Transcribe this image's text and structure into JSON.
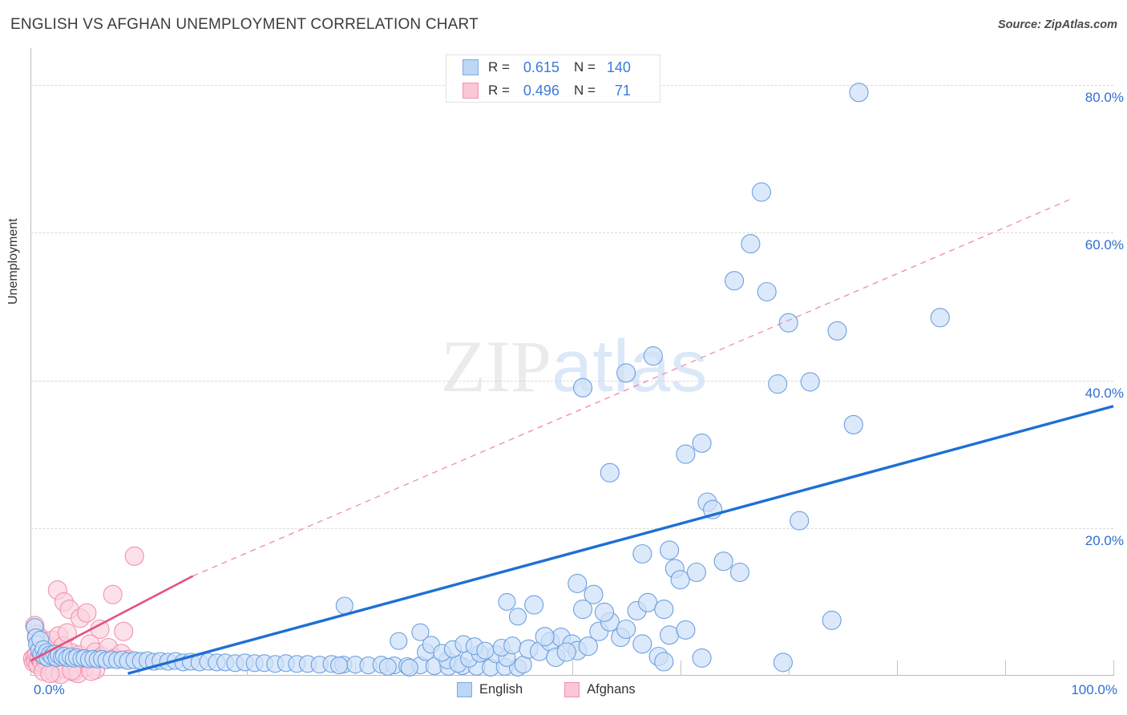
{
  "header": {
    "title": "ENGLISH VS AFGHAN UNEMPLOYMENT CORRELATION CHART",
    "source": "Source: ZipAtlas.com"
  },
  "watermark": {
    "part1": "ZIP",
    "part2": "atlas"
  },
  "stats": {
    "rows": [
      {
        "series": "English",
        "r_label": "R =",
        "r_value": "0.615",
        "n_label": "N =",
        "n_value": "140",
        "color": "#bcd7f5"
      },
      {
        "series": "Afghans",
        "r_label": "R =",
        "r_value": "0.496",
        "n_label": "N =",
        "n_value": "71",
        "color": "#fbc6d6"
      }
    ]
  },
  "legend": {
    "items": [
      {
        "label": "English",
        "color": "#bcd7f5"
      },
      {
        "label": "Afghans",
        "color": "#fbc6d6"
      }
    ]
  },
  "axes": {
    "y_title": "Unemployment",
    "y_ticks": [
      "80.0%",
      "60.0%",
      "40.0%",
      "20.0%"
    ],
    "x_left": "0.0%",
    "x_right": "100.0%"
  },
  "chart_data": {
    "type": "scatter",
    "title": "ENGLISH VS AFGHAN UNEMPLOYMENT CORRELATION CHART",
    "xlabel": "",
    "ylabel": "Unemployment",
    "xlim": [
      0,
      100
    ],
    "ylim": [
      0,
      85
    ],
    "x_unit": "%",
    "y_unit": "%",
    "grid": true,
    "y_gridlines": [
      20,
      40,
      60,
      80
    ],
    "x_ticks": [
      0,
      10,
      20,
      30,
      40,
      50,
      60,
      70,
      80,
      90,
      100
    ],
    "legend_position": "bottom-center",
    "statistics": [
      {
        "series": "English",
        "R": 0.615,
        "N": 140
      },
      {
        "series": "Afghans",
        "R": 0.496,
        "N": 71
      }
    ],
    "series": [
      {
        "name": "English",
        "color": "#cfe1f8",
        "edge_color": "#6ca0e0",
        "trendline": {
          "style": "solid",
          "color": "#1f6fd4",
          "x0": 9.0,
          "y0": 0.3,
          "x1": 100.0,
          "y1": 36.5
        },
        "points": [
          [
            0.4,
            6.6
          ],
          [
            0.5,
            5.2
          ],
          [
            0.6,
            4.3
          ],
          [
            0.8,
            3.5
          ],
          [
            0.9,
            4.9
          ],
          [
            1.0,
            3.0
          ],
          [
            1.2,
            3.6
          ],
          [
            1.3,
            2.6
          ],
          [
            1.5,
            3.2
          ],
          [
            1.6,
            2.4
          ],
          [
            1.8,
            2.9
          ],
          [
            2.0,
            2.6
          ],
          [
            2.2,
            3.0
          ],
          [
            2.4,
            2.4
          ],
          [
            2.6,
            2.8
          ],
          [
            2.9,
            2.5
          ],
          [
            3.1,
            2.7
          ],
          [
            3.4,
            2.4
          ],
          [
            3.7,
            2.6
          ],
          [
            4.0,
            2.3
          ],
          [
            4.3,
            2.5
          ],
          [
            4.7,
            2.3
          ],
          [
            5.0,
            2.4
          ],
          [
            5.4,
            2.2
          ],
          [
            5.8,
            2.3
          ],
          [
            6.2,
            2.2
          ],
          [
            6.6,
            2.3
          ],
          [
            7.0,
            2.1
          ],
          [
            7.5,
            2.2
          ],
          [
            8.0,
            2.1
          ],
          [
            8.5,
            2.2
          ],
          [
            9.0,
            2.0
          ],
          [
            9.6,
            2.1
          ],
          [
            10.2,
            2.0
          ],
          [
            10.8,
            2.1
          ],
          [
            11.4,
            1.9
          ],
          [
            12.0,
            2.0
          ],
          [
            12.7,
            1.9
          ],
          [
            13.4,
            2.0
          ],
          [
            14.1,
            1.8
          ],
          [
            14.8,
            1.9
          ],
          [
            15.6,
            1.8
          ],
          [
            16.4,
            1.9
          ],
          [
            17.2,
            1.8
          ],
          [
            18.0,
            1.8
          ],
          [
            18.9,
            1.7
          ],
          [
            19.8,
            1.8
          ],
          [
            20.7,
            1.7
          ],
          [
            21.6,
            1.7
          ],
          [
            22.6,
            1.6
          ],
          [
            23.6,
            1.7
          ],
          [
            24.6,
            1.6
          ],
          [
            25.6,
            1.6
          ],
          [
            26.7,
            1.5
          ],
          [
            27.8,
            1.6
          ],
          [
            28.9,
            1.5
          ],
          [
            30.0,
            1.5
          ],
          [
            31.2,
            1.4
          ],
          [
            32.4,
            1.5
          ],
          [
            33.6,
            1.4
          ],
          [
            34.8,
            1.3
          ],
          [
            36.0,
            1.4
          ],
          [
            37.3,
            1.3
          ],
          [
            38.6,
            1.2
          ],
          [
            39.9,
            1.3
          ],
          [
            41.2,
            1.2
          ],
          [
            42.5,
            1.1
          ],
          [
            43.8,
            1.2
          ],
          [
            45.0,
            1.1
          ],
          [
            34.0,
            4.7
          ],
          [
            36.5,
            3.2
          ],
          [
            38.5,
            2.1
          ],
          [
            39.5,
            1.6
          ],
          [
            40.5,
            2.3
          ],
          [
            41.5,
            3.0
          ],
          [
            43.0,
            2.9
          ],
          [
            44.0,
            2.4
          ],
          [
            45.5,
            1.5
          ],
          [
            36.0,
            5.9
          ],
          [
            37.0,
            4.2
          ],
          [
            38.0,
            3.1
          ],
          [
            39.0,
            3.6
          ],
          [
            40.0,
            4.3
          ],
          [
            41.0,
            4.0
          ],
          [
            42.0,
            3.4
          ],
          [
            43.5,
            3.8
          ],
          [
            44.5,
            4.1
          ],
          [
            46.0,
            3.6
          ],
          [
            47.0,
            3.3
          ],
          [
            48.0,
            4.6
          ],
          [
            49.0,
            5.2
          ],
          [
            50.0,
            4.3
          ],
          [
            50.5,
            3.4
          ],
          [
            51.5,
            4.0
          ],
          [
            52.5,
            6.0
          ],
          [
            53.5,
            7.3
          ],
          [
            54.5,
            5.2
          ],
          [
            55.0,
            6.3
          ],
          [
            29.0,
            9.5
          ],
          [
            33.0,
            1.2
          ],
          [
            28.5,
            1.4
          ],
          [
            35.0,
            1.1
          ],
          [
            46.5,
            9.6
          ],
          [
            47.5,
            5.3
          ],
          [
            48.5,
            2.5
          ],
          [
            49.5,
            3.2
          ],
          [
            44.0,
            10.0
          ],
          [
            45.0,
            8.0
          ],
          [
            50.5,
            12.5
          ],
          [
            52.0,
            11.0
          ],
          [
            51.0,
            9.0
          ],
          [
            53.0,
            8.6
          ],
          [
            56.0,
            8.8
          ],
          [
            57.0,
            9.9
          ],
          [
            56.5,
            4.3
          ],
          [
            58.0,
            2.6
          ],
          [
            59.0,
            17.0
          ],
          [
            59.5,
            14.5
          ],
          [
            60.0,
            13.0
          ],
          [
            58.5,
            9.0
          ],
          [
            53.5,
            27.5
          ],
          [
            51.0,
            39.0
          ],
          [
            55.0,
            41.0
          ],
          [
            57.5,
            43.3
          ],
          [
            60.5,
            30.0
          ],
          [
            62.0,
            31.5
          ],
          [
            56.5,
            16.5
          ],
          [
            59.0,
            5.5
          ],
          [
            60.5,
            6.2
          ],
          [
            61.5,
            14.0
          ],
          [
            62.5,
            23.5
          ],
          [
            63.0,
            22.5
          ],
          [
            62.0,
            2.4
          ],
          [
            58.5,
            1.9
          ],
          [
            64.0,
            15.5
          ],
          [
            65.5,
            14.0
          ],
          [
            68.0,
            52.0
          ],
          [
            65.0,
            53.5
          ],
          [
            66.5,
            58.5
          ],
          [
            67.5,
            65.5
          ],
          [
            69.0,
            39.5
          ],
          [
            72.0,
            39.8
          ],
          [
            70.0,
            47.8
          ],
          [
            74.5,
            46.7
          ],
          [
            76.0,
            34.0
          ],
          [
            71.0,
            21.0
          ],
          [
            69.5,
            1.8
          ],
          [
            74.0,
            7.5
          ],
          [
            76.5,
            79.0
          ],
          [
            84.0,
            48.5
          ]
        ]
      },
      {
        "name": "Afghans",
        "color": "#fbd2de",
        "edge_color": "#f292b0",
        "trendline_solid": {
          "style": "solid",
          "color": "#e4517f",
          "x0": 0.0,
          "y0": 2.0,
          "x1": 15.0,
          "y1": 13.5
        },
        "trendline_dashed": {
          "style": "dashed",
          "color": "#f08aa9",
          "x0": 15.0,
          "y0": 13.5,
          "x1": 96.0,
          "y1": 64.5
        },
        "points": [
          [
            0.2,
            2.3
          ],
          [
            0.3,
            1.8
          ],
          [
            0.4,
            2.6
          ],
          [
            0.5,
            2.0
          ],
          [
            0.6,
            2.9
          ],
          [
            0.7,
            1.5
          ],
          [
            0.8,
            2.4
          ],
          [
            0.9,
            3.2
          ],
          [
            1.0,
            2.1
          ],
          [
            1.1,
            1.7
          ],
          [
            1.2,
            2.7
          ],
          [
            1.3,
            2.2
          ],
          [
            1.4,
            3.0
          ],
          [
            1.5,
            1.9
          ],
          [
            1.6,
            2.5
          ],
          [
            1.7,
            1.4
          ],
          [
            1.8,
            2.8
          ],
          [
            1.9,
            2.1
          ],
          [
            2.0,
            2.3
          ],
          [
            2.1,
            1.6
          ],
          [
            2.2,
            2.6
          ],
          [
            2.3,
            3.3
          ],
          [
            2.4,
            1.8
          ],
          [
            2.5,
            2.2
          ],
          [
            2.6,
            2.9
          ],
          [
            2.8,
            2.0
          ],
          [
            3.0,
            2.5
          ],
          [
            3.2,
            1.5
          ],
          [
            3.4,
            2.7
          ],
          [
            3.6,
            2.1
          ],
          [
            3.8,
            3.1
          ],
          [
            4.0,
            1.9
          ],
          [
            4.2,
            2.4
          ],
          [
            4.5,
            2.8
          ],
          [
            4.8,
            2.2
          ],
          [
            0.4,
            6.8
          ],
          [
            0.6,
            5.6
          ],
          [
            0.8,
            4.4
          ],
          [
            1.0,
            5.0
          ],
          [
            1.5,
            4.2
          ],
          [
            2.0,
            4.8
          ],
          [
            2.6,
            5.4
          ],
          [
            3.0,
            4.0
          ],
          [
            3.4,
            5.8
          ],
          [
            2.5,
            11.6
          ],
          [
            3.1,
            10.0
          ],
          [
            3.6,
            9.0
          ],
          [
            4.6,
            7.8
          ],
          [
            5.2,
            8.5
          ],
          [
            6.4,
            6.3
          ],
          [
            7.6,
            11.0
          ],
          [
            8.6,
            6.0
          ],
          [
            5.5,
            4.3
          ],
          [
            6.0,
            3.2
          ],
          [
            6.6,
            2.6
          ],
          [
            7.2,
            3.8
          ],
          [
            7.8,
            2.4
          ],
          [
            8.4,
            3.0
          ],
          [
            9.0,
            2.2
          ],
          [
            1.2,
            0.6
          ],
          [
            2.2,
            0.4
          ],
          [
            3.2,
            0.9
          ],
          [
            4.0,
            0.5
          ],
          [
            5.0,
            1.1
          ],
          [
            2.8,
            0.2
          ],
          [
            4.4,
            0.3
          ],
          [
            6.0,
            0.8
          ],
          [
            9.6,
            16.2
          ],
          [
            3.8,
            0.7
          ],
          [
            1.8,
            0.3
          ],
          [
            5.6,
            0.6
          ]
        ]
      }
    ]
  }
}
